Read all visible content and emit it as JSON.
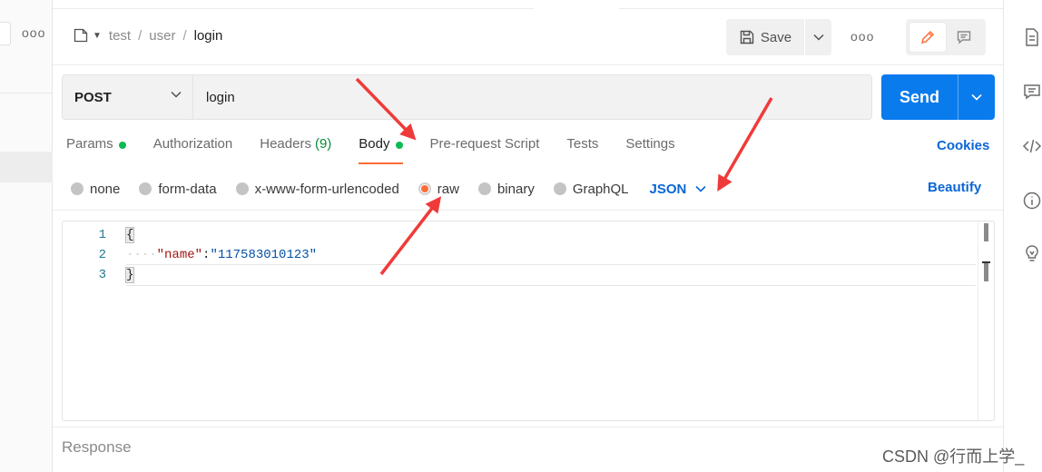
{
  "sidebar": {
    "more_label": "ooo"
  },
  "header": {
    "breadcrumb": [
      "test",
      "user",
      "login"
    ],
    "save_label": "Save",
    "more_label": "ooo"
  },
  "request": {
    "method": "POST",
    "url": "login",
    "send_label": "Send"
  },
  "tabs": [
    {
      "label": "Params",
      "count": "",
      "dot": true
    },
    {
      "label": "Authorization",
      "count": "",
      "dot": false
    },
    {
      "label": "Headers",
      "count": "(9)",
      "dot": false
    },
    {
      "label": "Body",
      "count": "",
      "dot": true,
      "active": true
    },
    {
      "label": "Pre-request Script",
      "count": "",
      "dot": false
    },
    {
      "label": "Tests",
      "count": "",
      "dot": false
    },
    {
      "label": "Settings",
      "count": "",
      "dot": false
    }
  ],
  "cookies_label": "Cookies",
  "body_types": [
    {
      "label": "none",
      "selected": false
    },
    {
      "label": "form-data",
      "selected": false
    },
    {
      "label": "x-www-form-urlencoded",
      "selected": false
    },
    {
      "label": "raw",
      "selected": true
    },
    {
      "label": "binary",
      "selected": false
    },
    {
      "label": "GraphQL",
      "selected": false
    }
  ],
  "raw_language": "JSON",
  "beautify_label": "Beautify",
  "editor": {
    "line_numbers": [
      "1",
      "2",
      "3"
    ],
    "open_brace": "{",
    "indent": "····",
    "key": "\"name\"",
    "colon": ":",
    "value": "\"117583010123\"",
    "close_brace": "}"
  },
  "response_label": "Response",
  "watermark": "CSDN @行而上学_",
  "colors": {
    "accent_orange": "#ff6c37",
    "send_blue": "#097bed",
    "link_blue": "#0b66d6",
    "status_green": "#0cbb52",
    "annotation_red": "#f03a3a"
  }
}
